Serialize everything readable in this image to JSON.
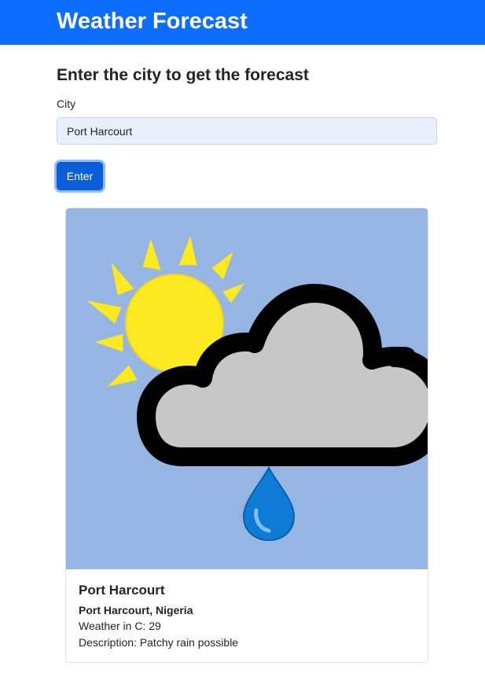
{
  "navbar": {
    "brand": "Weather Forecast"
  },
  "form": {
    "heading": "Enter the city to get the forecast",
    "city_label": "City",
    "city_value": "Port Harcourt",
    "submit_label": "Enter"
  },
  "result": {
    "icon": "patchy-rain-possible-icon",
    "title": "Port Harcourt",
    "location": "Port Harcourt, Nigeria",
    "temperature_line": "Weather in C: 29",
    "description_line": "Description: Patchy rain possible"
  },
  "colors": {
    "navbar": "#0d6efd",
    "button": "#0b5ed7",
    "input_autofill_bg": "#e8f0fe",
    "icon_sky": "#95b5e2",
    "sun": "#fce91f",
    "cloud": "#c7c7c7",
    "raindrop": "#0e7bd6"
  }
}
